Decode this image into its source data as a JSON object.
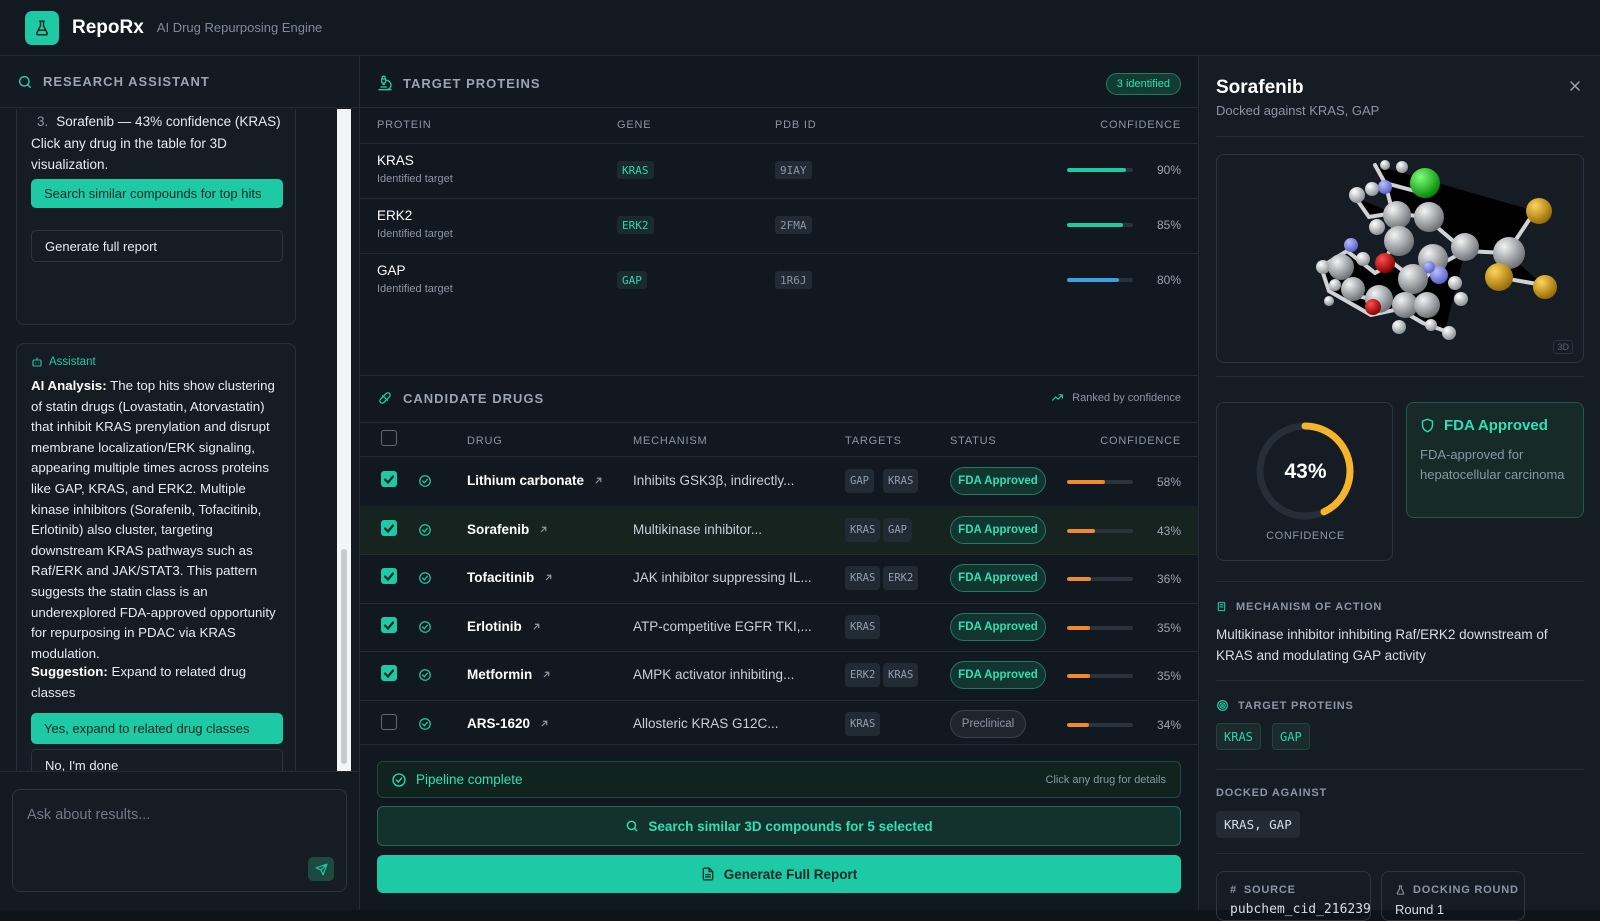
{
  "app": {
    "name": "RepoRx",
    "tagline": "AI Drug Repurposing Engine"
  },
  "assistant_panel": {
    "title": "RESEARCH ASSISTANT",
    "card1": {
      "list_item_number": "3.",
      "list_item": "Sorafenib — 43% confidence (KRAS)",
      "line1": "Click any drug in the table for 3D",
      "line2": "visualization.",
      "primary_action": "Search similar compounds for top hits",
      "secondary_action": "Generate full report"
    },
    "card2": {
      "label": "Assistant",
      "analysis_title": "AI Analysis:",
      "analysis_body": "The top hits show clustering of statin drugs (Lovastatin, Atorvastatin) that inhibit KRAS prenylation and disrupt membrane localization/ERK signaling, appearing multiple times across proteins like GAP, KRAS, and ERK2. Multiple kinase inhibitors (Sorafenib, Tofacitinib, Erlotinib) also cluster, targeting downstream KRAS pathways such as Raf/ERK and JAK/STAT3. This pattern suggests the statin class is an underexplored FDA-approved opportunity for repurposing in PDAC via KRAS modulation.",
      "suggestion_title": "Suggestion:",
      "suggestion_body": "Expand to related drug classes",
      "yes_action": "Yes, expand to related drug classes",
      "no_action": "No, I'm done"
    },
    "input_placeholder": "Ask about results..."
  },
  "target_proteins": {
    "title": "TARGET PROTEINS",
    "count_badge": "3 identified",
    "columns": [
      "PROTEIN",
      "GENE",
      "PDB ID",
      "CONFIDENCE"
    ],
    "rows": [
      {
        "protein": "KRAS",
        "sub": "Identified target",
        "gene": "KRAS",
        "pdb": "9IAY",
        "confidence": 90,
        "confidence_label": "90%",
        "color": "#1ec9a5"
      },
      {
        "protein": "ERK2",
        "sub": "Identified target",
        "gene": "ERK2",
        "pdb": "2FMA",
        "confidence": 85,
        "confidence_label": "85%",
        "color": "#1ec9a5"
      },
      {
        "protein": "GAP",
        "sub": "Identified target",
        "gene": "GAP",
        "pdb": "1R6J",
        "confidence": 80,
        "confidence_label": "80%",
        "color": "#3ca0e0"
      }
    ]
  },
  "candidate_drugs": {
    "title": "CANDIDATE DRUGS",
    "rank_note": "Ranked by confidence",
    "columns": [
      "DRUG",
      "MECHANISM",
      "TARGETS",
      "STATUS",
      "CONFIDENCE"
    ],
    "rows": [
      {
        "checked": true,
        "name": "Lithium carbonate",
        "mechanism": "Inhibits GSK3β, indirectly...",
        "targets": [
          "GAP",
          "KRAS"
        ],
        "status": "FDA Approved",
        "confidence": 58,
        "confidence_label": "58%"
      },
      {
        "checked": true,
        "name": "Sorafenib",
        "mechanism": "Multikinase inhibitor...",
        "targets": [
          "KRAS",
          "GAP"
        ],
        "status": "FDA Approved",
        "confidence": 43,
        "confidence_label": "43%"
      },
      {
        "checked": true,
        "name": "Tofacitinib",
        "mechanism": "JAK inhibitor suppressing IL...",
        "targets": [
          "KRAS",
          "ERK2"
        ],
        "status": "FDA Approved",
        "confidence": 36,
        "confidence_label": "36%"
      },
      {
        "checked": true,
        "name": "Erlotinib",
        "mechanism": "ATP-competitive EGFR TKI,...",
        "targets": [
          "KRAS"
        ],
        "status": "FDA Approved",
        "confidence": 35,
        "confidence_label": "35%"
      },
      {
        "checked": true,
        "name": "Metformin",
        "mechanism": "AMPK activator inhibiting...",
        "targets": [
          "ERK2",
          "KRAS"
        ],
        "status": "FDA Approved",
        "confidence": 35,
        "confidence_label": "35%"
      },
      {
        "checked": false,
        "name": "ARS-1620",
        "mechanism": "Allosteric KRAS G12C...",
        "targets": [
          "KRAS"
        ],
        "status": "Preclinical",
        "confidence": 34,
        "confidence_label": "34%"
      }
    ],
    "pipeline_status": "Pipeline complete",
    "pipeline_hint": "Click any drug for details",
    "search_action": "Search similar 3D compounds for 5 selected",
    "report_action": "Generate Full Report"
  },
  "details": {
    "title": "Sorafenib",
    "subtitle": "Docked against KRAS, GAP",
    "viewer_badge": "3D",
    "confidence": 43,
    "confidence_label": "43%",
    "confidence_caption": "CONFIDENCE",
    "status_title": "FDA Approved",
    "status_desc": "FDA-approved for hepatocellular carcinoma",
    "moa_title": "MECHANISM OF ACTION",
    "moa_text": "Multikinase inhibitor inhibiting Raf/ERK2 downstream of KRAS and modulating GAP activity",
    "targets_title": "TARGET PROTEINS",
    "targets": [
      "KRAS",
      "GAP"
    ],
    "docked_title": "DOCKED AGAINST",
    "docked_value": "KRAS, GAP",
    "source_label": "SOURCE",
    "source_value": "pubchem_cid_216239",
    "round_label": "DOCKING ROUND",
    "round_value": "Round 1"
  },
  "colors": {
    "accent": "#1ec9a5",
    "bar_orange": "#f08a2a",
    "ring": "#f5b52a"
  }
}
